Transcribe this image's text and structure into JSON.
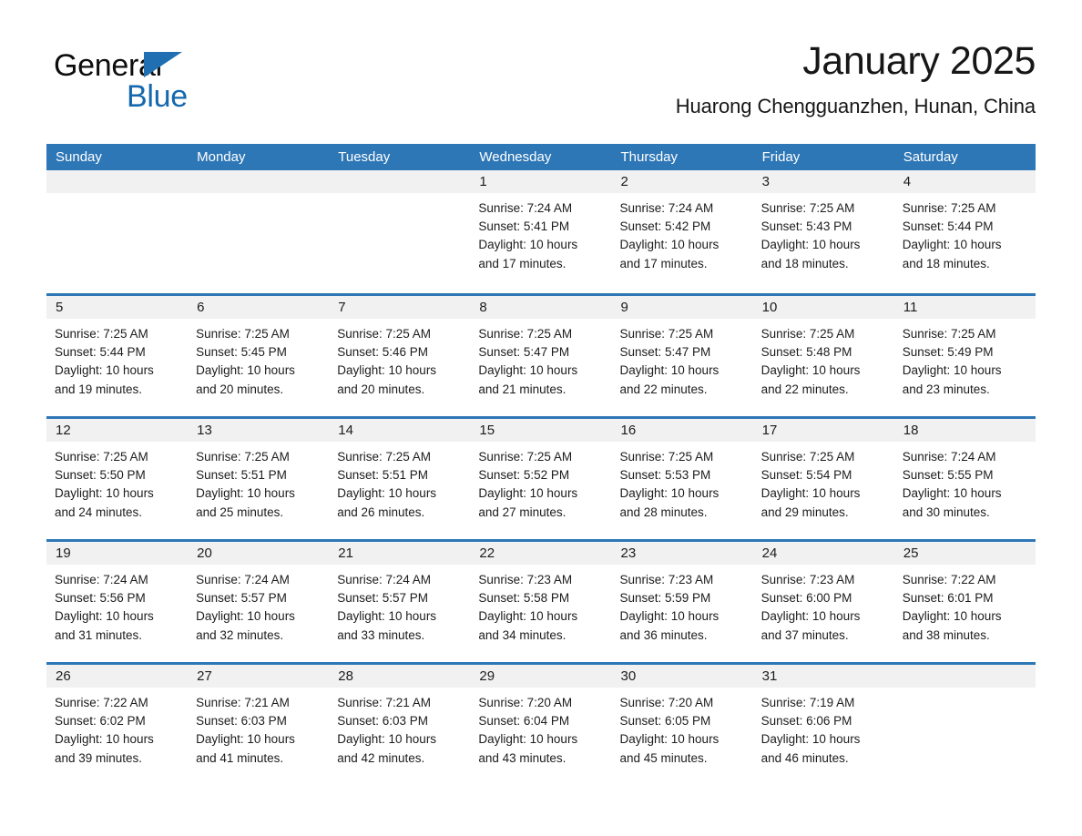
{
  "brand": {
    "word_one": "General",
    "word_two": "Blue",
    "triangle_color": "#1f6fb2",
    "blue_text_color": "#1668ad"
  },
  "header": {
    "title": "January 2025",
    "subtitle": "Huarong Chengguanzhen, Hunan, China"
  },
  "theme": {
    "header_blue": "#2e77b6",
    "row_rule_blue": "#2e77b6",
    "day_band_gray": "#f1f1f1",
    "text_color": "#1c1c1c"
  },
  "weekdays": [
    "Sunday",
    "Monday",
    "Tuesday",
    "Wednesday",
    "Thursday",
    "Friday",
    "Saturday"
  ],
  "weeks": [
    [
      {
        "day": "",
        "empty": true
      },
      {
        "day": "",
        "empty": true
      },
      {
        "day": "",
        "empty": true
      },
      {
        "day": "1",
        "sunrise": "Sunrise: 7:24 AM",
        "sunset": "Sunset: 5:41 PM",
        "daylight_line1": "Daylight: 10 hours",
        "daylight_line2": "and 17 minutes."
      },
      {
        "day": "2",
        "sunrise": "Sunrise: 7:24 AM",
        "sunset": "Sunset: 5:42 PM",
        "daylight_line1": "Daylight: 10 hours",
        "daylight_line2": "and 17 minutes."
      },
      {
        "day": "3",
        "sunrise": "Sunrise: 7:25 AM",
        "sunset": "Sunset: 5:43 PM",
        "daylight_line1": "Daylight: 10 hours",
        "daylight_line2": "and 18 minutes."
      },
      {
        "day": "4",
        "sunrise": "Sunrise: 7:25 AM",
        "sunset": "Sunset: 5:44 PM",
        "daylight_line1": "Daylight: 10 hours",
        "daylight_line2": "and 18 minutes."
      }
    ],
    [
      {
        "day": "5",
        "sunrise": "Sunrise: 7:25 AM",
        "sunset": "Sunset: 5:44 PM",
        "daylight_line1": "Daylight: 10 hours",
        "daylight_line2": "and 19 minutes."
      },
      {
        "day": "6",
        "sunrise": "Sunrise: 7:25 AM",
        "sunset": "Sunset: 5:45 PM",
        "daylight_line1": "Daylight: 10 hours",
        "daylight_line2": "and 20 minutes."
      },
      {
        "day": "7",
        "sunrise": "Sunrise: 7:25 AM",
        "sunset": "Sunset: 5:46 PM",
        "daylight_line1": "Daylight: 10 hours",
        "daylight_line2": "and 20 minutes."
      },
      {
        "day": "8",
        "sunrise": "Sunrise: 7:25 AM",
        "sunset": "Sunset: 5:47 PM",
        "daylight_line1": "Daylight: 10 hours",
        "daylight_line2": "and 21 minutes."
      },
      {
        "day": "9",
        "sunrise": "Sunrise: 7:25 AM",
        "sunset": "Sunset: 5:47 PM",
        "daylight_line1": "Daylight: 10 hours",
        "daylight_line2": "and 22 minutes."
      },
      {
        "day": "10",
        "sunrise": "Sunrise: 7:25 AM",
        "sunset": "Sunset: 5:48 PM",
        "daylight_line1": "Daylight: 10 hours",
        "daylight_line2": "and 22 minutes."
      },
      {
        "day": "11",
        "sunrise": "Sunrise: 7:25 AM",
        "sunset": "Sunset: 5:49 PM",
        "daylight_line1": "Daylight: 10 hours",
        "daylight_line2": "and 23 minutes."
      }
    ],
    [
      {
        "day": "12",
        "sunrise": "Sunrise: 7:25 AM",
        "sunset": "Sunset: 5:50 PM",
        "daylight_line1": "Daylight: 10 hours",
        "daylight_line2": "and 24 minutes."
      },
      {
        "day": "13",
        "sunrise": "Sunrise: 7:25 AM",
        "sunset": "Sunset: 5:51 PM",
        "daylight_line1": "Daylight: 10 hours",
        "daylight_line2": "and 25 minutes."
      },
      {
        "day": "14",
        "sunrise": "Sunrise: 7:25 AM",
        "sunset": "Sunset: 5:51 PM",
        "daylight_line1": "Daylight: 10 hours",
        "daylight_line2": "and 26 minutes."
      },
      {
        "day": "15",
        "sunrise": "Sunrise: 7:25 AM",
        "sunset": "Sunset: 5:52 PM",
        "daylight_line1": "Daylight: 10 hours",
        "daylight_line2": "and 27 minutes."
      },
      {
        "day": "16",
        "sunrise": "Sunrise: 7:25 AM",
        "sunset": "Sunset: 5:53 PM",
        "daylight_line1": "Daylight: 10 hours",
        "daylight_line2": "and 28 minutes."
      },
      {
        "day": "17",
        "sunrise": "Sunrise: 7:25 AM",
        "sunset": "Sunset: 5:54 PM",
        "daylight_line1": "Daylight: 10 hours",
        "daylight_line2": "and 29 minutes."
      },
      {
        "day": "18",
        "sunrise": "Sunrise: 7:24 AM",
        "sunset": "Sunset: 5:55 PM",
        "daylight_line1": "Daylight: 10 hours",
        "daylight_line2": "and 30 minutes."
      }
    ],
    [
      {
        "day": "19",
        "sunrise": "Sunrise: 7:24 AM",
        "sunset": "Sunset: 5:56 PM",
        "daylight_line1": "Daylight: 10 hours",
        "daylight_line2": "and 31 minutes."
      },
      {
        "day": "20",
        "sunrise": "Sunrise: 7:24 AM",
        "sunset": "Sunset: 5:57 PM",
        "daylight_line1": "Daylight: 10 hours",
        "daylight_line2": "and 32 minutes."
      },
      {
        "day": "21",
        "sunrise": "Sunrise: 7:24 AM",
        "sunset": "Sunset: 5:57 PM",
        "daylight_line1": "Daylight: 10 hours",
        "daylight_line2": "and 33 minutes."
      },
      {
        "day": "22",
        "sunrise": "Sunrise: 7:23 AM",
        "sunset": "Sunset: 5:58 PM",
        "daylight_line1": "Daylight: 10 hours",
        "daylight_line2": "and 34 minutes."
      },
      {
        "day": "23",
        "sunrise": "Sunrise: 7:23 AM",
        "sunset": "Sunset: 5:59 PM",
        "daylight_line1": "Daylight: 10 hours",
        "daylight_line2": "and 36 minutes."
      },
      {
        "day": "24",
        "sunrise": "Sunrise: 7:23 AM",
        "sunset": "Sunset: 6:00 PM",
        "daylight_line1": "Daylight: 10 hours",
        "daylight_line2": "and 37 minutes."
      },
      {
        "day": "25",
        "sunrise": "Sunrise: 7:22 AM",
        "sunset": "Sunset: 6:01 PM",
        "daylight_line1": "Daylight: 10 hours",
        "daylight_line2": "and 38 minutes."
      }
    ],
    [
      {
        "day": "26",
        "sunrise": "Sunrise: 7:22 AM",
        "sunset": "Sunset: 6:02 PM",
        "daylight_line1": "Daylight: 10 hours",
        "daylight_line2": "and 39 minutes."
      },
      {
        "day": "27",
        "sunrise": "Sunrise: 7:21 AM",
        "sunset": "Sunset: 6:03 PM",
        "daylight_line1": "Daylight: 10 hours",
        "daylight_line2": "and 41 minutes."
      },
      {
        "day": "28",
        "sunrise": "Sunrise: 7:21 AM",
        "sunset": "Sunset: 6:03 PM",
        "daylight_line1": "Daylight: 10 hours",
        "daylight_line2": "and 42 minutes."
      },
      {
        "day": "29",
        "sunrise": "Sunrise: 7:20 AM",
        "sunset": "Sunset: 6:04 PM",
        "daylight_line1": "Daylight: 10 hours",
        "daylight_line2": "and 43 minutes."
      },
      {
        "day": "30",
        "sunrise": "Sunrise: 7:20 AM",
        "sunset": "Sunset: 6:05 PM",
        "daylight_line1": "Daylight: 10 hours",
        "daylight_line2": "and 45 minutes."
      },
      {
        "day": "31",
        "sunrise": "Sunrise: 7:19 AM",
        "sunset": "Sunset: 6:06 PM",
        "daylight_line1": "Daylight: 10 hours",
        "daylight_line2": "and 46 minutes."
      },
      {
        "day": "",
        "empty": true
      }
    ]
  ]
}
